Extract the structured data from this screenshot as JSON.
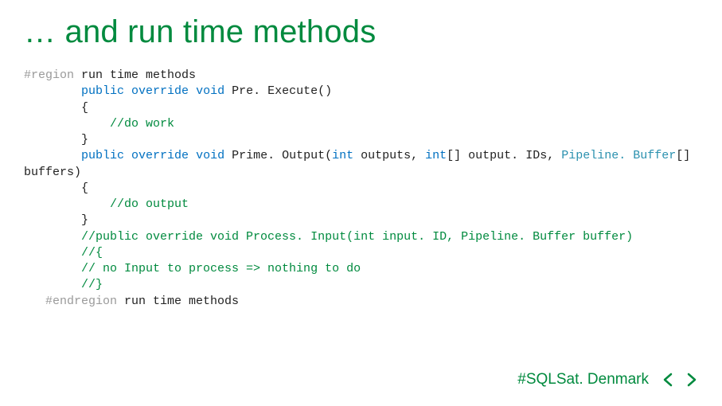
{
  "title": "… and run time methods",
  "code": {
    "l1a": "#region",
    "l1b": " run time methods",
    "l2a": "public",
    "l2b": "override",
    "l2c": "void",
    "l2d": " Pre. Execute()",
    "l3": "        {",
    "l4a": "            ",
    "l4b": "//do work",
    "l5": "        }",
    "l6a": "public",
    "l6b": "override",
    "l6c": "void",
    "l6d": " Prime. Output(",
    "l6e": "int",
    "l6f": " outputs, ",
    "l6g": "int",
    "l6h": "[] output. IDs, ",
    "l6i": "Pipeline. Buffer",
    "l6j": "[] ",
    "l7": "buffers)",
    "l8": "        {",
    "l9a": "            ",
    "l9b": "//do output",
    "l10": "        }",
    "l11": "//public override void Process. Input(int input. ID, Pipeline. Buffer buffer)",
    "l12": "//{",
    "l13": "// no Input to process => nothing to do",
    "l14": "//}",
    "l15a": "   #endregion",
    "l15b": " run time methods"
  },
  "footer": {
    "hashtag": "#SQLSat. Denmark"
  },
  "colors": {
    "accent": "#008a3e",
    "keyword": "#0070c1",
    "comment": "#008a3e",
    "type": "#2b91af",
    "directive": "#9a9a9a"
  }
}
